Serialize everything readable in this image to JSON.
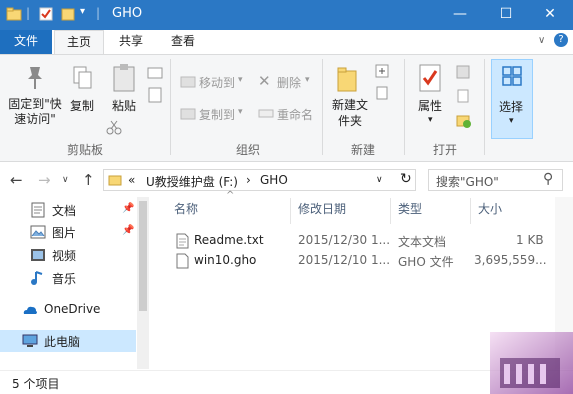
{
  "window": {
    "title": "GHO",
    "minimize": "—",
    "maximize": "☐",
    "close": "✕"
  },
  "tabs": {
    "file": "文件",
    "home": "主页",
    "share": "共享",
    "view": "查看"
  },
  "ribbon": {
    "clipboard": {
      "pin_quick_access": "固定到\"快速访问\"",
      "copy": "复制",
      "paste": "粘贴",
      "group": "剪贴板"
    },
    "organize": {
      "move_to": "移动到",
      "copy_to": "复制到",
      "delete": "删除",
      "rename": "重命名",
      "group": "组织"
    },
    "new": {
      "new_folder": "新建文件夹",
      "group": "新建"
    },
    "open": {
      "properties": "属性",
      "group": "打开"
    },
    "select": {
      "select": "选择"
    }
  },
  "address": {
    "prefix": "«",
    "drive": "U教授维护盘 (F:)",
    "separator": "›",
    "folder": "GHO",
    "search_placeholder": "搜索\"GHO\""
  },
  "nav_pane": {
    "items": [
      {
        "label": "文档",
        "icon": "documents-icon",
        "pinned": true
      },
      {
        "label": "图片",
        "icon": "pictures-icon",
        "pinned": true
      },
      {
        "label": "视频",
        "icon": "videos-icon",
        "pinned": false
      },
      {
        "label": "音乐",
        "icon": "music-icon",
        "pinned": false
      },
      {
        "label": "OneDrive",
        "icon": "onedrive-icon",
        "pinned": false
      },
      {
        "label": "此电脑",
        "icon": "this-pc-icon",
        "pinned": false,
        "selected": true
      }
    ]
  },
  "file_list": {
    "columns": [
      "名称",
      "修改日期",
      "类型",
      "大小"
    ],
    "rows": [
      {
        "name": "Readme.txt",
        "date": "2015/12/30 1...",
        "type": "文本文档",
        "size": "1 KB"
      },
      {
        "name": "win10.gho",
        "date": "2015/12/10 1...",
        "type": "GHO 文件",
        "size": "3,695,559..."
      }
    ]
  },
  "status": {
    "count": "5 个项目"
  },
  "colors": {
    "titlebar": "#2b78c5",
    "file_tab": "#1e6fbf",
    "selected_nav": "#cce8ff"
  }
}
